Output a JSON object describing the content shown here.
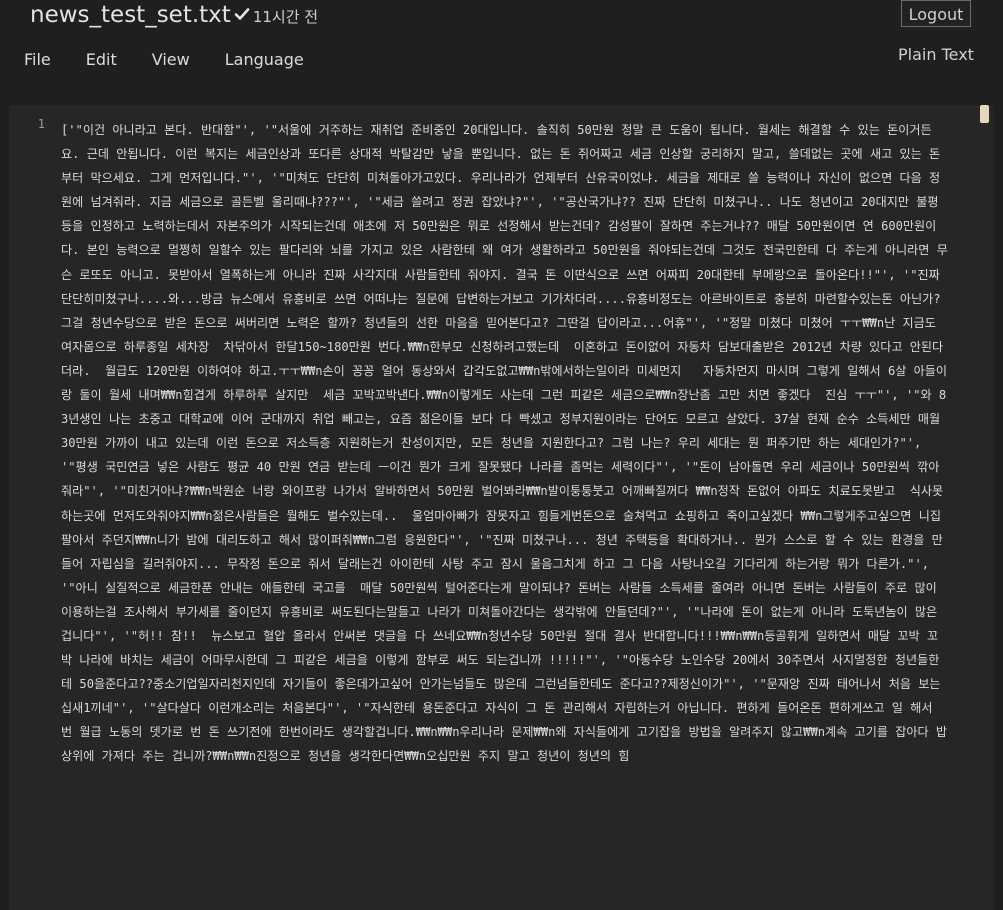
{
  "header": {
    "filename": "news_test_set.txt",
    "saved_time": "11시간 전",
    "logout_label": "Logout",
    "mode_label": "Plain Text"
  },
  "menu": {
    "file": "File",
    "edit": "Edit",
    "view": "View",
    "language": "Language"
  },
  "editor": {
    "line_number": "1",
    "content": "['\"이건 아니라고 본다. 반대함\"', '\"서울에 거주하는 재취업 준비중인 20대입니다. 솔직히 50만원 정말 큰 도움이 됩니다. 월세는 해결할 수 있는 돈이거든요. 근데 안됩니다. 이런 복지는 세금인상과 또다른 상대적 박탈감만 낳을 뿐입니다. 없는 돈 쥐어짜고 세금 인상할 궁리하지 말고, 쓸데없는 곳에 새고 있는 돈부터 막으세요. 그게 먼저입니다.\"', '\"미쳐도 단단히 미쳐돌아가고있다. 우리나라가 언제부터 산유국이었냐. 세금을 제대로 쓸 능력이나 자신이 없으면 다음 정원에 넘겨줘라. 지금 세금으로 골든벨 울리때냐???\"', '\"세금 쓸려고 정권 잡았냐?\"', '\"공산국가냐?? 진짜 단단히 미쳤구나.. 나도 청년이고 20대지만 불평등을 인정하고 노력하는데서 자본주의가 시작되는건데 애초에 저 50만원은 뭐로 선정해서 받는건데? 감성팔이 잘하면 주는거냐?? 매달 50만원이면 연 600만원이다. 본인 능력으로 멀쩡히 일할수 있는 팔다리와 뇌를 가지고 있은 사람한테 왜 여가 생활하라고 50만원을 줘야되는건데 그것도 전국민한테 다 주는게 아니라면 무슨 로또도 아니고. 못받아서 열폭하는게 아니라 진짜 사각지대 사람들한테 줘야지. 결국 돈 이딴식으로 쓰면 어짜피 20대한테 부메랑으로 돌아온다!!\"', '\"진짜 단단히미쳤구나....와...방금 뉴스에서 유흥비로 쓰면 어떠냐는 질문에 답변하는거보고 기가차더라....유흥비정도는 아르바이트로 충분히 마련할수있는돈 아닌가? 그걸 청년수당으로 받은 돈으로 써버리면 노력은 할까? 청년들의 선한 마음을 믿어본다고? 그딴걸 답이라고...어휴\"', '\"정말 미쳤다 미쳤어 ㅜㅜ₩₩n난 지금도 여자몸으로 하루종일 세차장  차닦아서 한달150~180만원 번다.₩₩n한부모 신청하려고했는데  이혼하고 돈이없어 자동차 담보대출받은 2012년 차량 있다고 안된다더라.  월급도 120만원 이하여야 하고.ㅜㅜ₩₩n손이 꽁꽁 얼어 동상와서 갑각도없고₩₩n밖에서하는일이라 미세먼지   자동차먼지 마시며 그렇게 일해서 6살 아들이랑 둘이 월세 내며₩₩n힘겹게 하루하루 살지만  세금 꼬박꼬박낸다.₩₩n이렇게도 사는데 그런 피같은 세금으로₩₩n장난좀 고만 치면 좋겠다  진심 ㅜㅜ\"', '\"와 83년생인 나는 초중고 대학교에 이어 군대까지 취업 빼고는, 요즘 젊은이들 보다 다 빡셌고 정부지원이라는 단어도 모르고 살았다. 37살 현재 순수 소득세만 매월 30만원 가까이 내고 있는데 이런 돈으로 저소득층 지원하는거 찬성이지만, 모든 청년을 지원한다고? 그럼 나는? 우리 세대는 뭔 퍼주기만 하는 세대인가?\"', '\"평생 국민연금 넣은 사람도 평균 40 만원 연금 받는데 ㅡ이건 뭔가 크게 잘못됐다 나라를 좀먹는 세력이다\"', '\"돈이 남아돌면 우리 세금이나 50만원씩 깎아줘라\"', '\"미친거아냐?₩₩n박원순 너랑 와이프랑 나가서 알바하면서 50만원 벌어봐라₩₩n발이퉁퉁붓고 어깨빠질꺼다 ₩₩n정작 돈없어 아파도 치료도못받고  식사못하는곳에 먼저도와줘야지₩₩n젊은사람들은 뭘해도 벌수있는데..  울엄마아빠가 잠못자고 힘들게번돈으로 술쳐먹고 쇼핑하고 죽이고싶겠다 ₩₩n그렇게주고싶으면 니집팔아서 주던지₩₩n니가 밤에 대리도하고 해서 많이퍼줘₩₩n그럼 응원한다\"', '\"진짜 미쳤구나... 청년 주택등을 확대하거나.. 뭔가 스스로 할 수 있는 환경을 만들어 자립심을 길러줘야지... 무작정 돈으로 줘서 달래는건 아이한테 사탕 주고 잠시 울음그치게 하고 그 다음 사탕나오길 기다리게 하는거랑 뭐가 다른가.\"', '\"아니 실질적으로 세금한푼 안내는 애들한테 국고를  매달 50만원씩 털어준다는게 말이되냐? 돈버는 사람들 소득세를 줄여라 아니면 돈버는 사람들이 주로 많이 이용하는걸 조사해서 부가세를 줄이던지 유흥비로 써도된다는말들고 나라가 미쳐돌아간다는 생각밖에 안들던데?\"', '\"나라에 돈이 없는게 아니라 도둑년놈이 많은 겁니다\"', '\"허!! 참!!  뉴스보고 혈압 올라서 안써본 댓글을 다 쓰네요₩₩n청년수당 50만원 절대 결사 반대합니다!!!₩₩n₩₩n등골휘게 일하면서 매달 꼬박 꼬박 나라에 바치는 세금이 어마무시한데 그 피같은 세금을 이렇게 함부로 써도 되는겁니까 !!!!!\"', '\"아동수당 노인수당 20에서 30주면서 사지멀정한 청년들한테 50을준다고??중소기업일자리천지인데 자기들이 좋은데가고싶어 안가는넘들도 많은데 그런넘들한테도 준다고??제정신이가\"', '\"문재앙 진짜 태어나서 처음 보는 십새1끼네\"', '\"살다살다 이런개소리는 처음본다\"', '\"자식한테 용돈준다고 자식이 그 돈 관리해서 자립하는거 아닙니다. 편하게 들어온돈 편하게쓰고 일 해서 번 월급 노동의 뎃가로 번 돈 쓰기전에 한번이라도 생각할겁니다.₩₩n₩₩n우리나라 문제₩₩n왜 자식들에게 고기잡을 방법을 알려주지 않고₩₩n계속 고기를 잡아다 밥상위에 가져다 주는 겁니까?₩₩n₩₩n진정으로 청년을 생각한다면₩₩n오십만원 주지 말고 청년이 청년의 힘"
  }
}
